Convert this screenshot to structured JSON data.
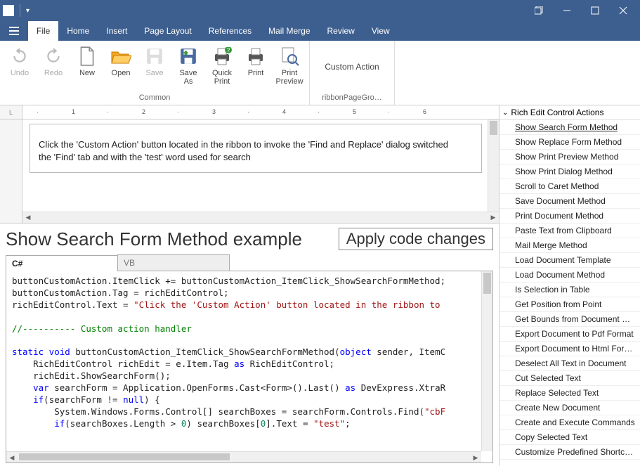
{
  "titlebar": {},
  "menu": {
    "items": [
      "File",
      "Home",
      "Insert",
      "Page Layout",
      "References",
      "Mail Merge",
      "Review",
      "View"
    ],
    "active_index": 0
  },
  "ribbon": {
    "buttons": [
      {
        "label": "Undo",
        "disabled": true
      },
      {
        "label": "Redo",
        "disabled": true
      },
      {
        "label": "New",
        "disabled": false
      },
      {
        "label": "Open",
        "disabled": false
      },
      {
        "label": "Save",
        "disabled": true
      },
      {
        "label": "Save As",
        "disabled": false
      },
      {
        "label": "Quick Print",
        "disabled": false
      },
      {
        "label": "Print",
        "disabled": false
      },
      {
        "label": "Print Preview",
        "disabled": false
      }
    ],
    "group1_label": "Common",
    "custom_action_label": "Custom Action",
    "group2_label": "ribbonPageGro…"
  },
  "ruler": {
    "corner": "L",
    "marks": [
      "",
      "1",
      "",
      "2",
      "",
      "3",
      "",
      "4",
      "",
      "5",
      "",
      "6"
    ]
  },
  "document": {
    "line1": "Click the 'Custom Action' button located in the ribbon to invoke the 'Find and Replace' dialog switched",
    "line2": "the 'Find' tab and with the 'test' word used for search"
  },
  "example": {
    "title": "Show Search Form Method example",
    "apply_label": "Apply code changes",
    "tabs": [
      "C#",
      "VB"
    ],
    "active_tab": 0
  },
  "code": {
    "l1a": "buttonCustomAction.ItemClick += buttonCustomAction_ItemClick_ShowSearchFormMethod;",
    "l2a": "buttonCustomAction.Tag = richEditControl;",
    "l3a": "richEditControl.Text = ",
    "l3b": "\"Click the 'Custom Action' button located in the ribbon to ",
    "l5a": "//---------- Custom action handler",
    "l7a": "static",
    "l7b": " void",
    "l7c": " buttonCustomAction_ItemClick_ShowSearchFormMethod(",
    "l7d": "object",
    "l7e": " sender, ItemC",
    "l8a": "    RichEditControl richEdit = e.Item.Tag ",
    "l8b": "as",
    "l8c": " RichEditControl;",
    "l9a": "    richEdit.ShowSearchForm();",
    "l10a": "    ",
    "l10b": "var",
    "l10c": " searchForm = Application.OpenForms.Cast<Form>().Last() ",
    "l10d": "as",
    "l10e": " DevExpress.XtraR",
    "l11a": "    ",
    "l11b": "if",
    "l11c": "(searchForm != ",
    "l11d": "null",
    "l11e": ") {",
    "l12a": "        System.Windows.Forms.Control[] searchBoxes = searchForm.Controls.Find(",
    "l12b": "\"cbF",
    "l13a": "        ",
    "l13b": "if",
    "l13c": "(searchBoxes.Length > ",
    "l13d": "0",
    "l13e": ") searchBoxes[",
    "l13f": "0",
    "l13g": "].Text = ",
    "l13h": "\"test\"",
    "l13i": ";"
  },
  "actions_panel": {
    "header": "Rich Edit Control Actions",
    "items": [
      "Show Search Form Method",
      "Show Replace Form Method",
      "Show Print Preview Method",
      "Show Print Dialog Method",
      "Scroll to Caret Method",
      "Save Document Method",
      "Print Document Method",
      "Paste Text from Clipboard",
      "Mail Merge Method",
      "Load Document Template",
      "Load Document Method",
      "Is Selection in Table",
      "Get Position from Point",
      "Get Bounds from Document Po…",
      "Export Document to Pdf Format",
      "Export Document to Html For…",
      "Deselect All Text in Document",
      "Cut Selected Text",
      "Replace Selected Text",
      "Create New Document",
      "Create and Execute Commands",
      "Copy Selected Text",
      "Customize Predefined Shortcut…"
    ],
    "selected_index": 0
  }
}
